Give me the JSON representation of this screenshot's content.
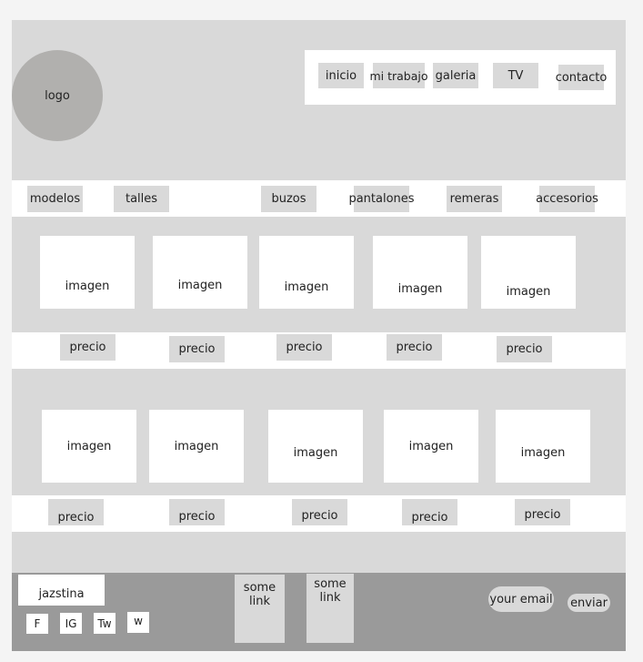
{
  "logo": "logo",
  "nav": [
    "inicio",
    "mi trabajo",
    "galeria",
    "TV",
    "contacto"
  ],
  "categories": [
    "modelos",
    "talles",
    "buzos",
    "pantalones",
    "remeras",
    "accesorios"
  ],
  "products": {
    "row1": {
      "image_label": [
        "imagen",
        "imagen",
        "imagen",
        "imagen",
        "imagen"
      ],
      "price_label": [
        "precio",
        "precio",
        "precio",
        "precio",
        "precio"
      ]
    },
    "row2": {
      "image_label": [
        "imagen",
        "imagen",
        "imagen",
        "imagen",
        "imagen"
      ],
      "price_label": [
        "precio",
        "precio",
        "precio",
        "precio",
        "precio"
      ]
    }
  },
  "footer": {
    "brand": "jazstina",
    "social": [
      "F",
      "IG",
      "Tw",
      "w"
    ],
    "links": [
      "some link",
      "some link"
    ],
    "email_placeholder": "your email",
    "send": "enviar"
  }
}
